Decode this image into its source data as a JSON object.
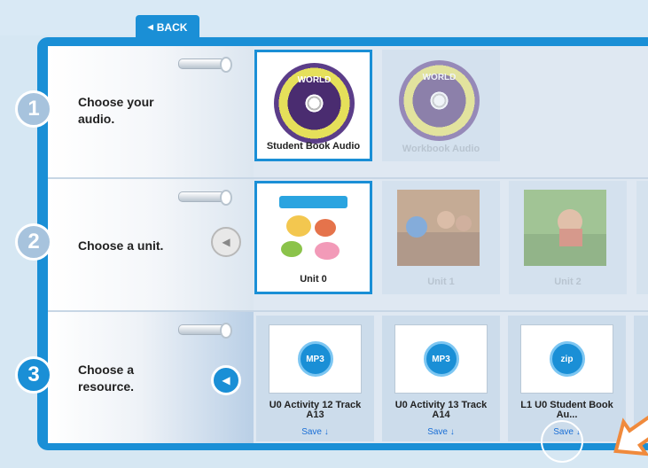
{
  "nav": {
    "back_label": "BACK"
  },
  "steps": [
    {
      "number": "1",
      "label_line1": "Choose your",
      "label_line2": "audio."
    },
    {
      "number": "2",
      "label_line1": "Choose a unit.",
      "label_line2": ""
    },
    {
      "number": "3",
      "label_line1": "Choose a",
      "label_line2": "resource."
    }
  ],
  "audio_options": [
    {
      "label": "Student Book Audio",
      "cd_title": "WORLD",
      "selected": true
    },
    {
      "label": "Workbook Audio",
      "cd_title": "WORLD",
      "selected": false
    }
  ],
  "units": [
    {
      "label": "Unit 0",
      "selected": true
    },
    {
      "label": "Unit 1",
      "selected": false
    },
    {
      "label": "Unit 2",
      "selected": false
    }
  ],
  "resources": [
    {
      "title": "U0 Activity 12 Track A13",
      "icon_text": "MP3",
      "save_label": "Save"
    },
    {
      "title": "U0 Activity 13 Track A14",
      "icon_text": "MP3",
      "save_label": "Save"
    },
    {
      "title": "L1 U0 Student Book Au...",
      "icon_text": "zip",
      "save_label": "Save"
    }
  ],
  "colors": {
    "accent": "#1a8fd6",
    "panel": "#dfe8f2",
    "card": "#ccdceb",
    "highlight": "#f08a3c"
  },
  "icons": {
    "back": "triangle-left-icon",
    "unit_arrow": "chevron-left-icon",
    "resource_arrow": "chevron-left-icon",
    "mp3": "mp3-icon",
    "zip": "zip-icon",
    "save": "download-arrow-icon"
  }
}
